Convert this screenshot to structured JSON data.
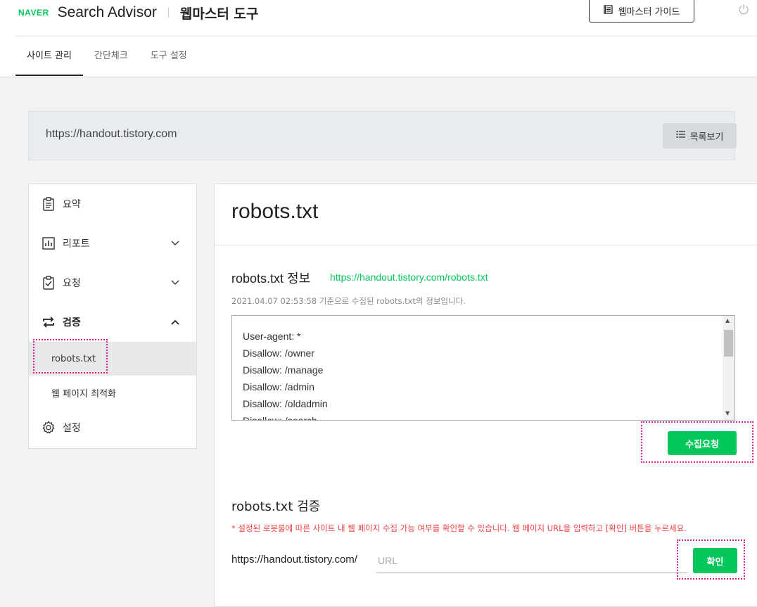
{
  "header": {
    "naver_logo": "NAVER",
    "app_name": "Search Advisor",
    "tool_name": "웹마스터 도구",
    "guide_button": "웹마스터 가이드",
    "power_icon": "power-icon"
  },
  "tabs": [
    {
      "label": "사이트 관리",
      "active": true
    },
    {
      "label": "간단체크",
      "active": false
    },
    {
      "label": "도구 설정",
      "active": false
    }
  ],
  "site": {
    "url": "https://handout.tistory.com",
    "list_button": "목록보기"
  },
  "sidebar": {
    "items": [
      {
        "label": "요약",
        "icon": "clipboard-icon"
      },
      {
        "label": "리포트",
        "icon": "chart-icon"
      },
      {
        "label": "요청",
        "icon": "clipboard-check-icon"
      },
      {
        "label": "검증",
        "icon": "swap-arrows-icon"
      },
      {
        "label": "설정",
        "icon": "gear-icon"
      }
    ],
    "sub_items": [
      {
        "label": "robots.txt",
        "selected": true
      },
      {
        "label": "웹 페이지 최적화",
        "selected": false
      }
    ]
  },
  "main": {
    "page_title": "robots.txt",
    "info_section": {
      "title": "robots.txt 정보",
      "link": "https://handout.tistory.com/robots.txt",
      "date_note": "2021.04.07 02:53:58 기준으로 수집된 robots.txt의 정보입니다.",
      "robots_lines": [
        "User-agent: *",
        "Disallow: /owner",
        "Disallow: /manage",
        "Disallow: /admin",
        "Disallow: /oldadmin",
        "Disallow: /search"
      ],
      "collect_button": "수집요청"
    },
    "verify_section": {
      "title": "robots.txt 검증",
      "warning": "* 설정된 로봇룰에 따른 사이트 내 웹 페이지 수집 가능 여부를 확인할 수 있습니다. 웹 페이지 URL을 입력하고 [확인] 버튼을 누르세요.",
      "url_prefix": "https://handout.tistory.com/",
      "url_placeholder": "URL",
      "url_value": "",
      "confirm_button": "확인"
    }
  },
  "colors": {
    "naver_green": "#03c75a",
    "highlight_dotted": "#e0208a",
    "warning_red": "#f04040"
  }
}
